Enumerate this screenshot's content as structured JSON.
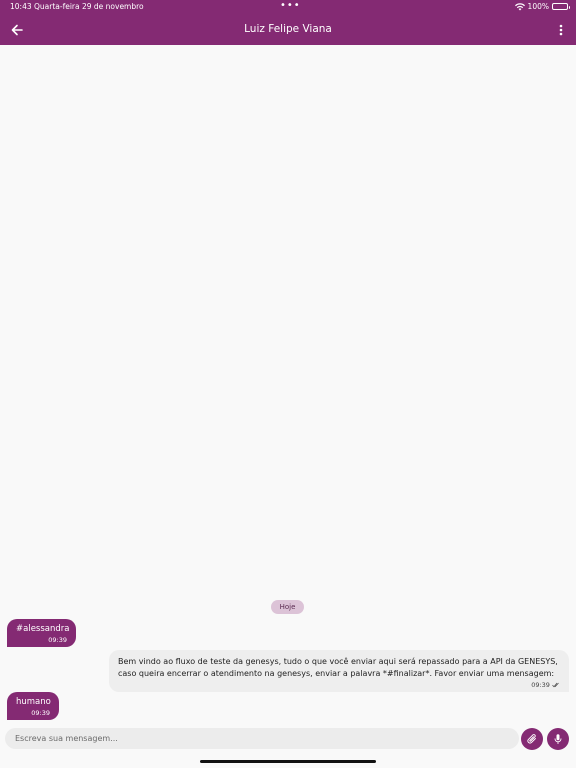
{
  "status_bar": {
    "time": "10:43",
    "date": "Quarta-feira 29 de novembro",
    "dots": "•••",
    "battery": "100%"
  },
  "header": {
    "title": "Luiz Felipe Viana",
    "back_icon": "arrow-left-icon",
    "menu_icon": "more-vertical-icon"
  },
  "chat": {
    "date_separator": "Hoje",
    "messages": [
      {
        "direction": "in",
        "text": "#alessandra",
        "time": "09:39"
      },
      {
        "direction": "out",
        "text": "Bem vindo ao fluxo de teste da genesys, tudo o que você enviar aqui será repassado para a API da GENESYS, caso queira encerrar o atendimento na genesys, enviar a palavra *#finalizar*. Favor enviar uma mensagem:",
        "time": "09:39",
        "status_icon": "double-check-icon"
      },
      {
        "direction": "in",
        "text": "humano",
        "time": "09:39"
      }
    ]
  },
  "composer": {
    "placeholder": "Escreva sua mensagem...",
    "attach_icon": "paperclip-icon",
    "mic_icon": "microphone-icon"
  },
  "colors": {
    "primary": "#842a73",
    "chip": "#dcc3d7",
    "outgoing_bubble": "#eeeeee",
    "background": "#f9f9f9"
  }
}
